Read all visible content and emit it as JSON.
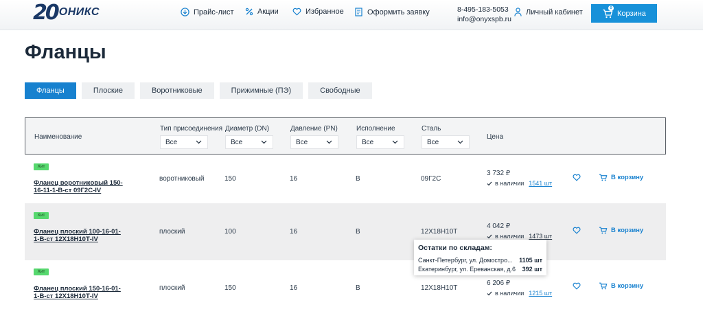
{
  "header": {
    "logo_number": "20",
    "logo_text": "ОНИКС",
    "nav": [
      {
        "label": "Прайс-лист",
        "icon": "download-icon"
      },
      {
        "label": "Акции",
        "icon": "percent-icon"
      },
      {
        "label": "Избранное",
        "icon": "heart-icon"
      },
      {
        "label": "Оформить заявку",
        "icon": "form-icon"
      }
    ],
    "phone": "8-495-183-5053",
    "email": "info@onyxspb.ru",
    "account_label": "Личный кабинет",
    "cart_label": "Корзина",
    "cart_count": "0"
  },
  "page_title": "Фланцы",
  "tabs": [
    {
      "label": "Фланцы",
      "active": true
    },
    {
      "label": "Плоские",
      "active": false
    },
    {
      "label": "Воротниковые",
      "active": false
    },
    {
      "label": "Прижимные (ПЭ)",
      "active": false
    },
    {
      "label": "Свободные",
      "active": false
    }
  ],
  "table": {
    "headers": {
      "name": "Наименование",
      "connection": "Тип присоединения",
      "diameter": "Диаметр (DN)",
      "pressure": "Давление (PN)",
      "execution": "Исполнение",
      "steel": "Сталь",
      "price": "Цена"
    },
    "filter_value": "Все",
    "badge": "Хит",
    "in_stock_label": "в наличии",
    "add_to_cart_label": "В корзину",
    "rows": [
      {
        "name": "Фланец воротниковый 150-16-11-1-В-ст 09Г2С-IV",
        "connection": "воротниковый",
        "diameter": "150",
        "pressure": "16",
        "execution": "B",
        "steel": "09Г2С",
        "price": "3 732 ₽",
        "qty": "1541 шт"
      },
      {
        "name": "Фланец плоский 100-16-01-1-В-ст 12Х18Н10Т-IV",
        "connection": "плоский",
        "diameter": "100",
        "pressure": "16",
        "execution": "B",
        "steel": "12Х18Н10Т",
        "price": "4 042 ₽",
        "qty": "1473 шт"
      },
      {
        "name": "Фланец плоский 150-16-01-1-В-ст 12Х18Н10Т-IV",
        "connection": "плоский",
        "diameter": "150",
        "pressure": "16",
        "execution": "B",
        "steel": "12Х18Н10Т",
        "price": "6 206 ₽",
        "qty": "1215 шт"
      }
    ]
  },
  "tooltip": {
    "title": "Остатки по складам:",
    "lines": [
      {
        "place": "Санкт-Петербург, ул. Домостро...",
        "qty": "1105 шт"
      },
      {
        "place": "Екатеринбург, ул. Ереванская, д.6",
        "qty": "392 шт"
      }
    ]
  },
  "colors": {
    "accent": "#1781cf",
    "cart": "#1791d9",
    "badge": "#56d86e",
    "brand": "#1a3866"
  }
}
